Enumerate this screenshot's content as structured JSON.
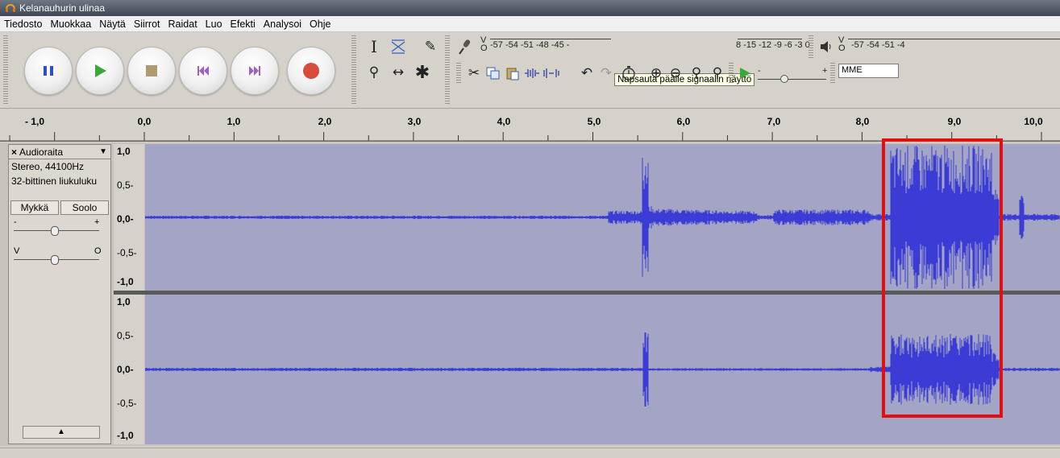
{
  "window": {
    "title": "Kelanauhurin ulinaa"
  },
  "menu": [
    "Tiedosto",
    "Muokkaa",
    "Näytä",
    "Siirrot",
    "Raidat",
    "Luo",
    "Efekti",
    "Analysoi",
    "Ohje"
  ],
  "transport": {
    "pause_icon": "pause-icon",
    "play_icon": "play-icon",
    "stop_icon": "stop-icon",
    "skip_start_icon": "skip-to-start-icon",
    "skip_end_icon": "skip-to-end-icon",
    "record_icon": "record-icon"
  },
  "meters": {
    "record_scale": "-57 -54 -51 -48 -45 -",
    "record_tail": "8 -15 -12 -9 -6 -3 0",
    "play_scale": "-57 -54 -51 -4",
    "channel_v": "V",
    "channel_o": "O",
    "tooltip": "Napsauta päälle signaalin näyttö"
  },
  "mixer": {
    "minus": "-",
    "plus": "+"
  },
  "host": "MME",
  "ruler": {
    "labels": [
      "- 1,0",
      "0,0",
      "1,0",
      "2,0",
      "3,0",
      "4,0",
      "5,0",
      "6,0",
      "7,0",
      "8,0",
      "9,0",
      "10,0"
    ]
  },
  "track": {
    "close": "×",
    "name": "Audioraita",
    "dropdown": "▼",
    "format": "Stereo, 44100Hz",
    "sample_format": "32-bittinen liukuluku",
    "mute": "Mykkä",
    "solo": "Soolo",
    "gain_minus": "-",
    "gain_plus": "+",
    "pan_left": "V",
    "pan_right": "O",
    "collapse": "▲"
  },
  "vruler": {
    "top": [
      "1,0",
      "0,5-",
      "0,0-",
      "-0,5-",
      "-1,0"
    ],
    "bottom": [
      "1,0",
      "0,5-",
      "0,0-",
      "-0,5-",
      "-1,0"
    ]
  },
  "colors": {
    "waveform": "#3b3bd6",
    "waveform_bg": "#a4a4c4",
    "highlight": "#e01010"
  }
}
